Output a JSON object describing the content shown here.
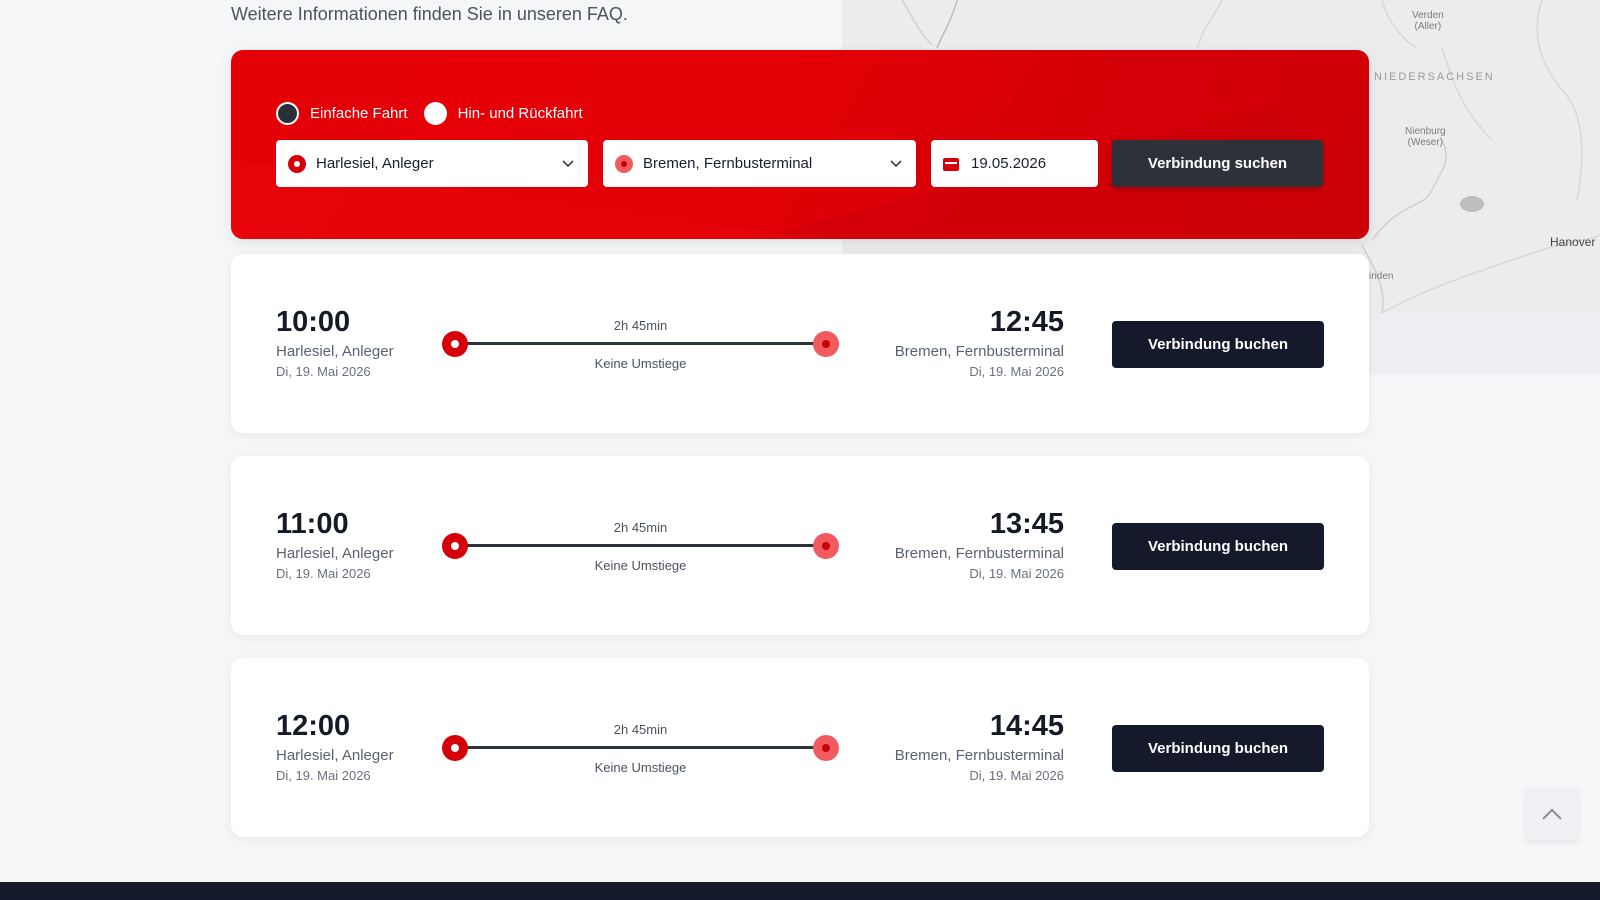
{
  "info": {
    "text": "Weitere Informationen finden Sie in unseren FAQ."
  },
  "map": {
    "labels": {
      "verden": "Verden\n(Aller)",
      "niedersachsen": "NIEDERSACHSEN",
      "nienburg": "Nienburg\n(Weser)",
      "hannover": "Hanover",
      "minden": "inden"
    }
  },
  "search": {
    "trip_types": [
      {
        "label": "Einfache Fahrt",
        "selected": true
      },
      {
        "label": "Hin- und Rückfahrt",
        "selected": false
      }
    ],
    "origin": "Harlesiel, Anleger",
    "destination": "Bremen, Fernbusterminal",
    "date": "19.05.2026",
    "search_label": "Verbindung suchen"
  },
  "results": [
    {
      "dep_time": "10:00",
      "dep_place": "Harlesiel, Anleger",
      "dep_date": "Di, 19. Mai 2026",
      "duration": "2h 45min",
      "transfers": "Keine Umstiege",
      "arr_time": "12:45",
      "arr_place": "Bremen, Fernbusterminal",
      "arr_date": "Di, 19. Mai 2026",
      "book_label": "Verbindung buchen"
    },
    {
      "dep_time": "11:00",
      "dep_place": "Harlesiel, Anleger",
      "dep_date": "Di, 19. Mai 2026",
      "duration": "2h 45min",
      "transfers": "Keine Umstiege",
      "arr_time": "13:45",
      "arr_place": "Bremen, Fernbusterminal",
      "arr_date": "Di, 19. Mai 2026",
      "book_label": "Verbindung buchen"
    },
    {
      "dep_time": "12:00",
      "dep_place": "Harlesiel, Anleger",
      "dep_date": "Di, 19. Mai 2026",
      "duration": "2h 45min",
      "transfers": "Keine Umstiege",
      "arr_time": "14:45",
      "arr_place": "Bremen, Fernbusterminal",
      "arr_date": "Di, 19. Mai 2026",
      "book_label": "Verbindung buchen"
    }
  ],
  "icons": {
    "origin": "location-pin-icon",
    "destination": "location-pin-icon",
    "date": "calendar-icon",
    "dropdown": "chevron-down-icon",
    "scroll_top": "chevron-up-icon"
  },
  "colors": {
    "brand_red": "#e30006",
    "dark_button": "#141a2b",
    "search_button": "#2e3137",
    "destination_pin": "#f15a5f"
  }
}
